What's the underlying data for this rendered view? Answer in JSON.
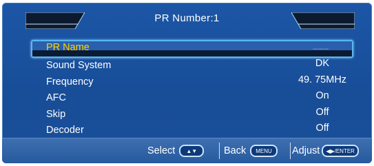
{
  "header": {
    "title": "PR Number:1"
  },
  "menu": {
    "items": [
      {
        "label": "PR Name",
        "value": "___",
        "selected": true
      },
      {
        "label": "Sound System",
        "value": "DK"
      },
      {
        "label": "Frequency",
        "value": "49. 75MHz"
      },
      {
        "label": "AFC",
        "value": "On"
      },
      {
        "label": "Skip",
        "value": "Off"
      },
      {
        "label": "Decoder",
        "value": "Off"
      }
    ]
  },
  "footer": {
    "select_label": "Select",
    "select_key": "▲▼",
    "back_label": "Back",
    "back_key": "MENU",
    "adjust_label": "Adjust",
    "adjust_key": "◀▶/ENTER"
  },
  "colors": {
    "panel": "#1c56a6",
    "highlight_border": "#59b7ec",
    "selected_text": "#ffd200",
    "text": "#ffffff"
  }
}
